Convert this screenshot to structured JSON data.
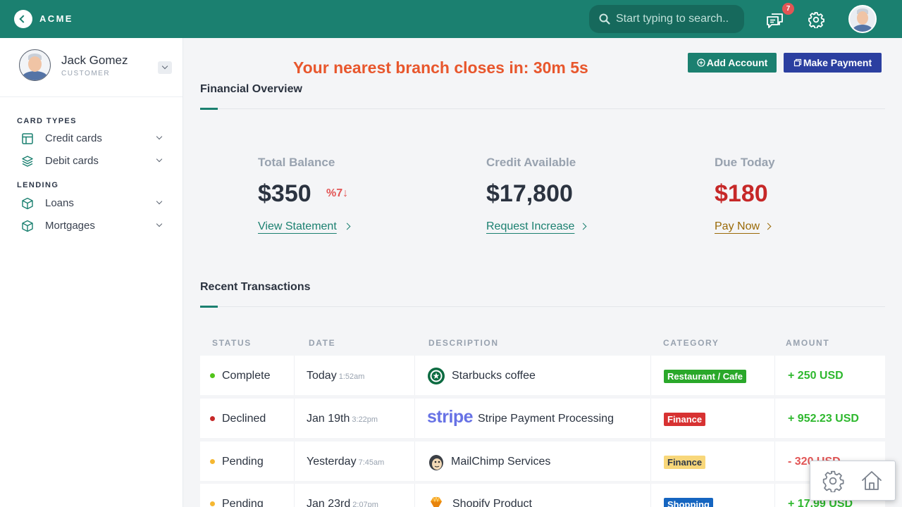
{
  "app": {
    "brand": "ACME"
  },
  "search": {
    "placeholder": "Start typing to search.."
  },
  "notifications": {
    "count": "7"
  },
  "user": {
    "name": "Jack Gomez",
    "role": "CUSTOMER"
  },
  "sidebar": {
    "sections": [
      {
        "heading": "CARD TYPES",
        "items": [
          {
            "label": "Credit cards",
            "icon": "layout-icon"
          },
          {
            "label": "Debit cards",
            "icon": "layers-icon"
          }
        ]
      },
      {
        "heading": "LENDING",
        "items": [
          {
            "label": "Loans",
            "icon": "box-icon"
          },
          {
            "label": "Mortgages",
            "icon": "box-icon"
          }
        ]
      }
    ]
  },
  "banner": {
    "text": "Your nearest branch closes in: 30m 5s"
  },
  "actions": {
    "add_account": "Add Account",
    "make_payment": "Make Payment"
  },
  "overview": {
    "title": "Financial Overview",
    "stats": [
      {
        "label": "Total Balance",
        "value": "$350",
        "change": "%7↓",
        "link": "View Statement"
      },
      {
        "label": "Credit Available",
        "value": "$17,800",
        "link": "Request Increase"
      },
      {
        "label": "Due Today",
        "value": "$180",
        "link": "Pay Now"
      }
    ]
  },
  "transactions": {
    "title": "Recent Transactions",
    "columns": [
      "STATUS",
      "DATE",
      "DESCRIPTION",
      "CATEGORY",
      "AMOUNT"
    ],
    "rows": [
      {
        "status": "Complete",
        "date": "Today",
        "time": "1:52am",
        "merchant_icon": "starbucks-icon",
        "description": "Starbucks coffee",
        "category": "Restaurant / Cafe",
        "amount": "+ 250 USD"
      },
      {
        "status": "Declined",
        "date": "Jan 19th",
        "time": "3:22pm",
        "merchant_icon": "stripe-icon",
        "merchant_logo": "stripe",
        "description": "Stripe Payment Processing",
        "category": "Finance",
        "amount": "+ 952.23 USD"
      },
      {
        "status": "Pending",
        "date": "Yesterday",
        "time": "7:45am",
        "merchant_icon": "mailchimp-icon",
        "description": "MailChimp Services",
        "category": "Finance",
        "amount": "- 320 USD"
      },
      {
        "status": "Pending",
        "date": "Jan 23rd",
        "time": "2:07pm",
        "merchant_icon": "shopify-icon",
        "description": "Shopify Product",
        "category": "Shopping",
        "amount": "+ 17.99 USD"
      }
    ]
  },
  "colors": {
    "brand": "#1b8070",
    "accent_orange": "#e8572d",
    "pay_button": "#2b3fa0",
    "status_complete": "#52c41a",
    "status_declined": "#c62828",
    "status_pending": "#f5b731",
    "amount_positive": "#2eb82e",
    "amount_negative": "#e25555",
    "badge_restaurant": "#2aa82a",
    "badge_finance_red": "#d73232",
    "badge_finance_yellow": "#f8d77a",
    "badge_shopping": "#1565c0"
  }
}
